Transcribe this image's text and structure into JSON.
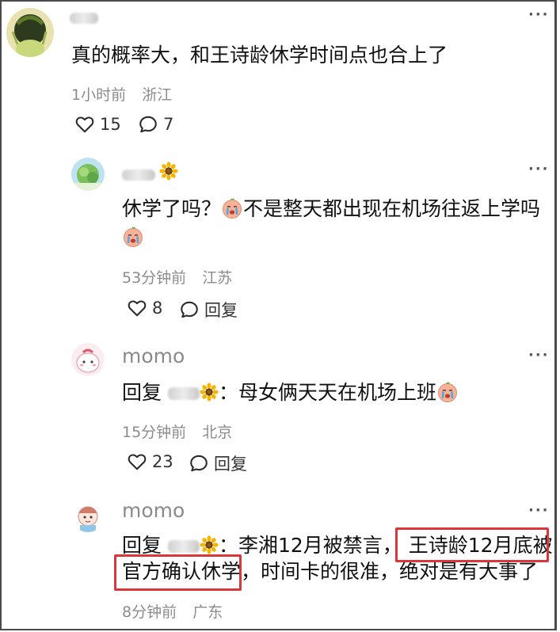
{
  "comments": [
    {
      "text": "真的概率大，和王诗龄休学时间点也合上了",
      "time": "1小时前",
      "location": "浙江",
      "likes": "15",
      "replies": "7"
    },
    {
      "text_a": "休学了吗？",
      "text_b": "不是整天都出现在机场往返上学吗",
      "time": "53分钟前",
      "location": "江苏",
      "likes": "8",
      "reply_label": "回复"
    },
    {
      "username": "momo",
      "reply_prefix": "回复",
      "text": "：母女俩天天在机场上班",
      "time": "15分钟前",
      "location": "北京",
      "likes": "23",
      "reply_label": "回复"
    },
    {
      "username": "momo",
      "reply_prefix": "回复",
      "line1_a": "：李湘12月被禁言，",
      "line1_b": "王诗龄12月底被",
      "line2_a": "官方确认休学",
      "line2_b": "，时间卡的很准，绝对是有大事了",
      "time": "8分钟前",
      "location": "广东"
    }
  ],
  "colors": {
    "highlight_box": "#d9383a",
    "meta": "#8c8c8c",
    "username": "#8a8a8a"
  },
  "icons": [
    "heart-icon",
    "comment-bubble-icon",
    "more-dots-icon",
    "crying-emoji-icon",
    "sunflower-icon"
  ]
}
